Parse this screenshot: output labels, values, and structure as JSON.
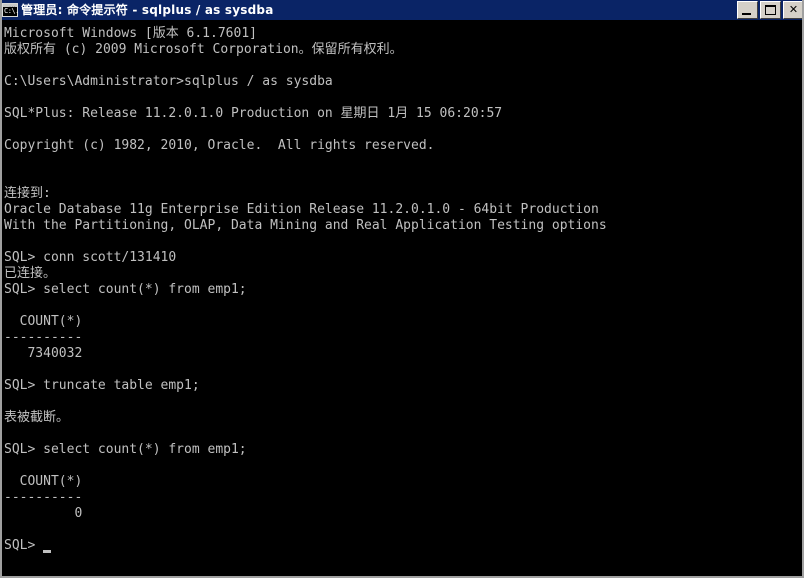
{
  "window": {
    "title": "管理员: 命令提示符 - sqlplus  / as sysdba",
    "icon": "cmd-icon",
    "icon_text": "C:\\.",
    "buttons": {
      "minimize": "_",
      "maximize": "□",
      "close": "✕"
    }
  },
  "console": {
    "background_color": "#000000",
    "text_color": "#c0c0c0",
    "lines": [
      "Microsoft Windows [版本 6.1.7601]",
      "版权所有 (c) 2009 Microsoft Corporation。保留所有权利。",
      "",
      "C:\\Users\\Administrator>sqlplus / as sysdba",
      "",
      "SQL*Plus: Release 11.2.0.1.0 Production on 星期日 1月 15 06:20:57 ",
      "",
      "Copyright (c) 1982, 2010, Oracle.  All rights reserved.",
      "",
      "",
      "连接到:",
      "Oracle Database 11g Enterprise Edition Release 11.2.0.1.0 - 64bit Production",
      "With the Partitioning, OLAP, Data Mining and Real Application Testing options",
      "",
      "SQL> conn scott/131410",
      "已连接。",
      "SQL> select count(*) from emp1;",
      "",
      "  COUNT(*)",
      "----------",
      "   7340032",
      "",
      "SQL> truncate table emp1;",
      "",
      "表被截断。",
      "",
      "SQL> select count(*) from emp1;",
      "",
      "  COUNT(*)",
      "----------",
      "         0",
      "",
      "SQL> "
    ],
    "cursor": {
      "shape": "underline-block",
      "visible": true
    }
  }
}
